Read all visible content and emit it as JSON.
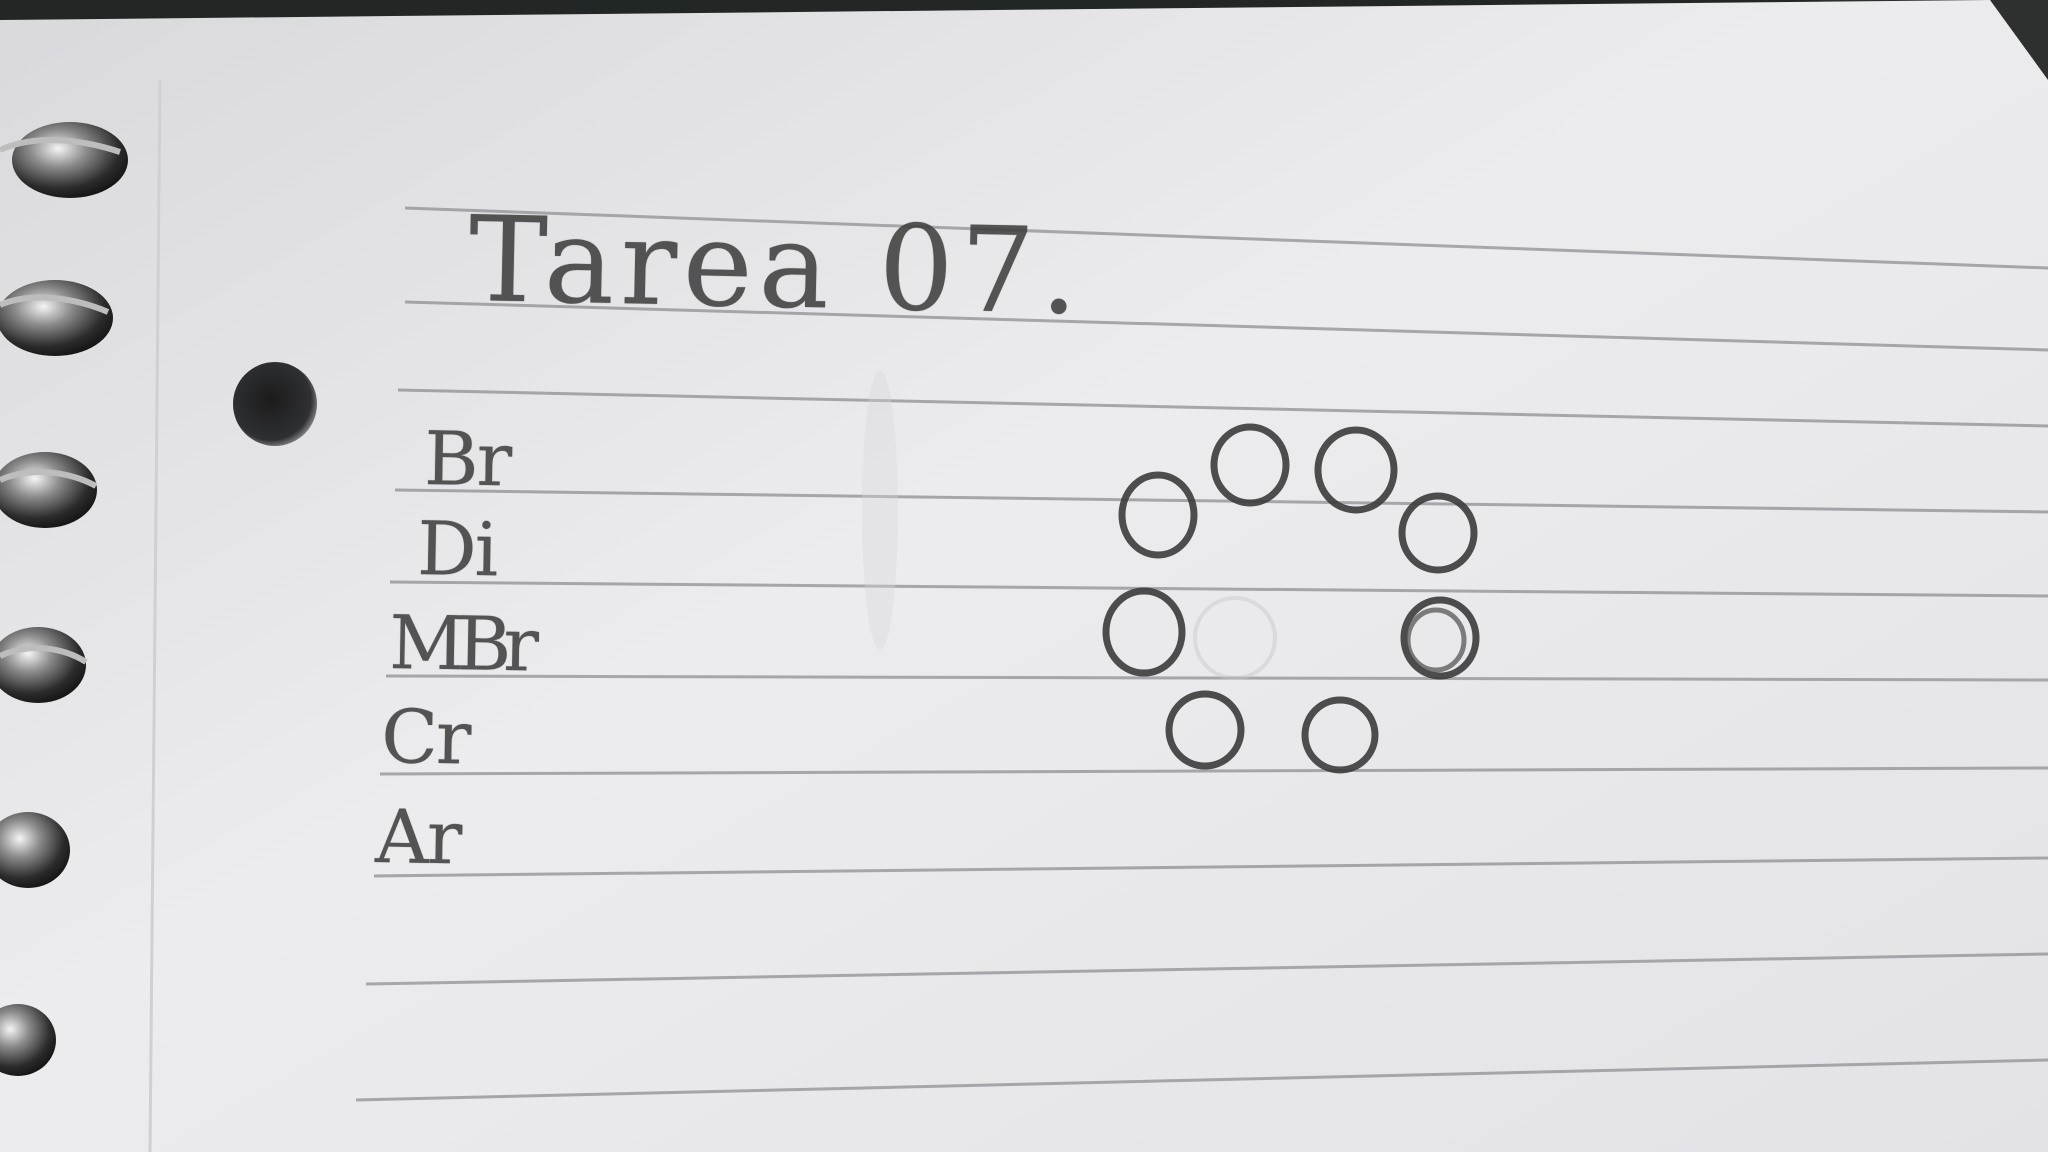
{
  "notebook": {
    "title": "Tarea 07.",
    "notes": [
      "Br",
      "Di",
      "MBr",
      "Cr",
      "Ar"
    ],
    "circle_count": 9
  },
  "colors": {
    "paper": "#e9e9ea",
    "rule_line": "#8f8f94",
    "pencil": "#3f3f3f",
    "background": "#1f2221"
  }
}
